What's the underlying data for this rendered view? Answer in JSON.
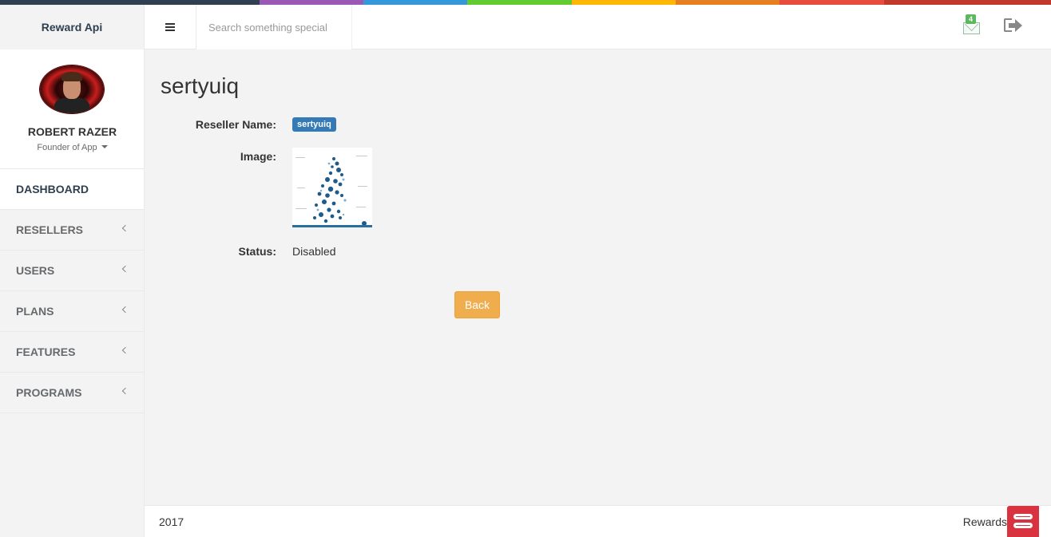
{
  "colorbar": [
    "#2f4050",
    "#9b59b6",
    "#3498db",
    "#62cb31",
    "#ffb606",
    "#e67e22",
    "#e74c3c",
    "#c0392b"
  ],
  "topnav": {
    "brand": "Reward Api",
    "search_placeholder": "Search something special",
    "mail_badge": "4"
  },
  "profile": {
    "name": "ROBERT RAZER",
    "role": "Founder of App"
  },
  "menu": [
    {
      "label": "DASHBOARD",
      "active": true
    },
    {
      "label": "RESELLERS"
    },
    {
      "label": "USERS"
    },
    {
      "label": "PLANS"
    },
    {
      "label": "FEATURES"
    },
    {
      "label": "PROGRAMS"
    }
  ],
  "detail": {
    "title": "sertyuiq",
    "reseller_label": "Reseller Name:",
    "reseller_value": "sertyuiq",
    "image_label": "Image:",
    "status_label": "Status:",
    "status_value": "Disabled",
    "back_label": "Back"
  },
  "footer": {
    "year": "2017",
    "right": "Rewards"
  }
}
